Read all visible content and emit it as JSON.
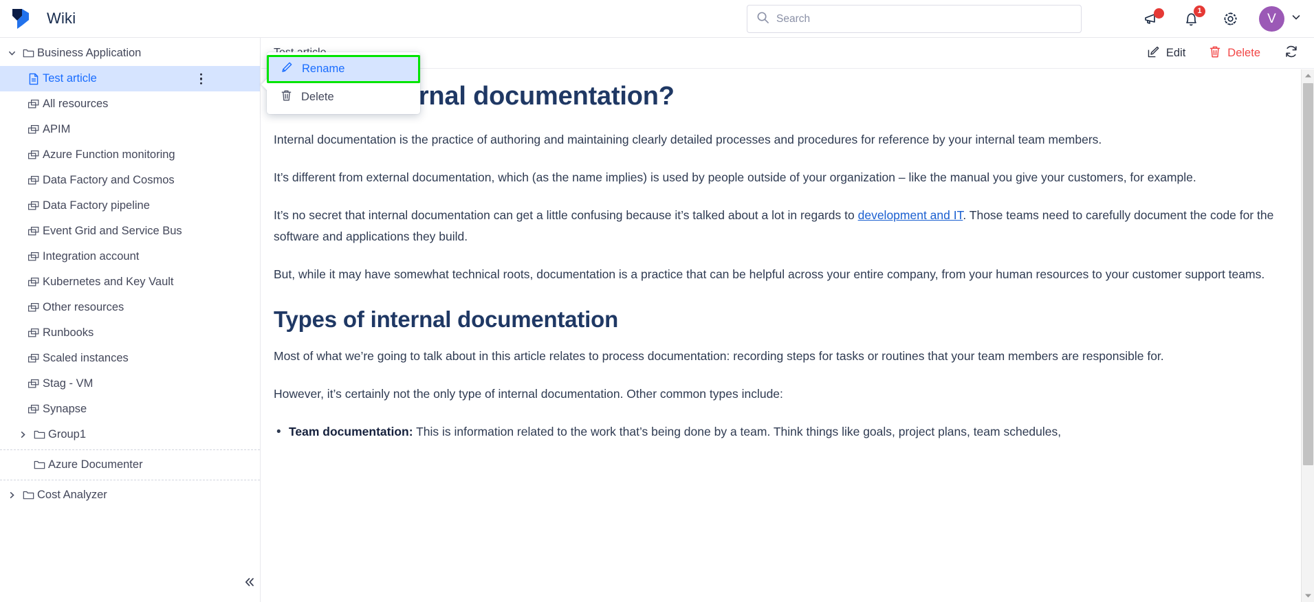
{
  "header": {
    "brand_title": "Wiki",
    "logo_icon": "confluence-logo-icon",
    "search": {
      "placeholder": "Search",
      "value": "",
      "icon": "search-icon"
    },
    "actions": [
      {
        "icon": "megaphone-icon",
        "badge": "",
        "badge_type": "dot"
      },
      {
        "icon": "bell-icon",
        "badge": "1",
        "badge_type": "count"
      },
      {
        "icon": "gear-icon",
        "badge": "",
        "badge_type": "none"
      }
    ],
    "avatar": {
      "initial": "V",
      "color": "#9b59b6",
      "chevron_icon": "chevron-down-icon"
    }
  },
  "sidebar": {
    "collapse_icon": "chevrons-left-icon",
    "groups": [
      {
        "label": "Business Application",
        "icon": "folder-icon",
        "caret_icon": "chevron-down-icon",
        "expanded": true,
        "children": [
          {
            "label": "Test article",
            "icon": "document-icon",
            "selected": true,
            "kebab_icon": "more-vertical-icon"
          },
          {
            "label": "All resources",
            "icon": "windows-icon",
            "selected": false
          },
          {
            "label": "APIM",
            "icon": "windows-icon",
            "selected": false
          },
          {
            "label": "Azure Function monitoring",
            "icon": "windows-icon",
            "selected": false
          },
          {
            "label": "Data Factory and Cosmos",
            "icon": "windows-icon",
            "selected": false
          },
          {
            "label": "Data Factory pipeline",
            "icon": "windows-icon",
            "selected": false
          },
          {
            "label": "Event Grid and Service Bus",
            "icon": "windows-icon",
            "selected": false
          },
          {
            "label": "Integration account",
            "icon": "windows-icon",
            "selected": false
          },
          {
            "label": "Kubernetes and Key Vault",
            "icon": "windows-icon",
            "selected": false
          },
          {
            "label": "Other resources",
            "icon": "windows-icon",
            "selected": false
          },
          {
            "label": "Runbooks",
            "icon": "windows-icon",
            "selected": false
          },
          {
            "label": "Scaled instances",
            "icon": "windows-icon",
            "selected": false
          },
          {
            "label": "Stag - VM",
            "icon": "windows-icon",
            "selected": false
          },
          {
            "label": "Synapse",
            "icon": "windows-icon",
            "selected": false
          },
          {
            "label": "Group1",
            "icon": "folder-icon",
            "caret_icon": "chevron-right-icon",
            "expanded": false,
            "is_folder": true
          }
        ]
      },
      {
        "label": "Azure Documenter",
        "icon": "folder-icon",
        "caret_icon": "",
        "expanded": false,
        "children": []
      },
      {
        "label": "Cost Analyzer",
        "icon": "folder-icon",
        "caret_icon": "chevron-right-icon",
        "expanded": false,
        "children": []
      }
    ]
  },
  "context_menu": {
    "highlighted": "Rename",
    "items": [
      {
        "label": "Rename",
        "icon": "pencil-icon",
        "active": true
      },
      {
        "label": "Delete",
        "icon": "trash-icon",
        "active": false
      }
    ]
  },
  "content_header": {
    "breadcrumb": "Test article",
    "actions": [
      {
        "label": "Edit",
        "icon": "edit-pencil-icon",
        "danger": false
      },
      {
        "label": "Delete",
        "icon": "trash-icon",
        "danger": true
      },
      {
        "label": "",
        "icon": "refresh-icon",
        "danger": false
      }
    ]
  },
  "article": {
    "h1": "What is internal documentation?",
    "p1": "Internal documentation is the practice of authoring and maintaining clearly detailed processes and procedures for reference by your internal team members.",
    "p2": "It’s different from external documentation, which (as the name implies) is used by people outside of your organization – like the manual you give your customers, for example.",
    "p3_before": "It’s no secret that internal documentation can get a little confusing because it’s talked about a lot in regards to ",
    "p3_link": "development and IT",
    "p3_after": ". Those teams need to carefully document the code for the software and applications they build.",
    "p4": "But, while it may have somewhat technical roots, documentation is a practice that can be helpful across your entire company, from your human resources to your customer support teams.",
    "h2": "Types of internal documentation",
    "p5": "Most of what we’re going to talk about in this article relates to process documentation: recording steps for tasks or routines that your team members are responsible for.",
    "p6": "However, it’s certainly not the only type of internal documentation. Other common types include:",
    "bullet1_bold": "Team documentation:",
    "bullet1_text": " This is information related to the work that’s being done by a team. Think things like goals, project plans, team schedules,"
  },
  "scrollbar": {
    "up_icon": "caret-up-icon",
    "down_icon": "caret-down-icon",
    "thumb_position_pct": 0,
    "thumb_size_pct": 72
  },
  "colors": {
    "accent_blue": "#1a6dff",
    "selection_bg": "#d6e4ff",
    "highlight_green": "#00e500",
    "danger_red": "#f24646",
    "heading_navy": "#1f3864",
    "avatar_purple": "#9b59b6"
  }
}
